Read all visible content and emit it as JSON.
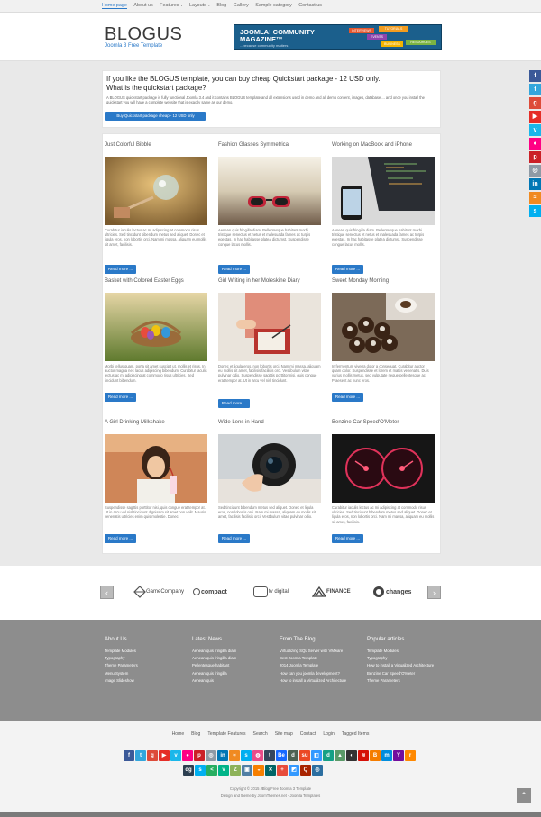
{
  "nav": {
    "items": [
      "Home page",
      "About us",
      "Features",
      "Layouts",
      "Blog",
      "Gallery",
      "Sample category",
      "Contact us"
    ],
    "dropdown_caret": "▾"
  },
  "header": {
    "title": "BLOGUS",
    "subtitle": "Joomla 3 Free Template",
    "banner_title": "JOOMLA! COMMUNITY MAGAZINE",
    "banner_tm": "™",
    "banner_sub": "...because community matters",
    "banner_tags": [
      "INTERVIEWS",
      "TUTORIALS",
      "EVENTS",
      "RESOURCES",
      "BUSINESS"
    ]
  },
  "promo": {
    "heading_line1": "If you like the BLOGUS template, you can buy cheap Quickstart package - 12 USD only.",
    "heading_line2": "What is the quickstart package?",
    "body": "A BLOGUS quickstart package is fully functional Joomla 3.4 and it contains BLOGUS template and all extensions used in demo and all demo content, images, database ... and once you install the quickstart you will have a complete website that is exactly same as our demo.",
    "button": "Buy Quickstart package cheap - 12 USD only"
  },
  "articles": [
    {
      "title": "Just Colorful Bibble",
      "desc": "Curabitur iaculis lectus ac mi adipiscing at commodo risus ultricies. Sed tincidunt bibendum metus sed aliquet. Donec et ligula eros, non lobortis orci. Nam mi massa, aliquam eu mollis sit amet, facilisis.",
      "button": "Read more ..."
    },
    {
      "title": "Fashion Glasses Symmetrical",
      "desc": "Aenean quis fringilla diam. Pellentesque habitant morbi tristique senectus et netus et malesuada fames ac turpis egestas. In hac habitasse platea dictumst. Suspendisse congue lacus mollis.",
      "button": "Read more ..."
    },
    {
      "title": "Working on MacBook and iPhone",
      "desc": "Aenean quis fringilla diam. Pellentesque habitant morbi tristique senectus et netus et malesuada fames ac turpis egestas. In hac habitasse platea dictumst. Suspendisse congue lacus mollis.",
      "button": "Read more ..."
    },
    {
      "title": "Basket with Colored Easter Eggs",
      "desc": "Morbi tellus quam, porta sit amet suscipit ut, mollis et risus. In auctor magna nec lacus adipiscing bibendum. Curabitur iaculis lectus ac mi adipiscing at commodo risus ultricies. Sed tincidunt bibendum.",
      "button": "Read more ..."
    },
    {
      "title": "Girl Writing in her Moleskine Diary",
      "desc": "Donec et ligula eros, non lobortis orci. Nam mi massa, aliquam eu mollis sit amet, facilisis facilisis orci. Vestibulum vitae pulvinar odio. Suspendisse sagittis porttitor nisi, quis congue erat tempor at. Ut in arcu vel nisl tincidunt.",
      "button": "Read more ..."
    },
    {
      "title": "Sweet Monday Morning",
      "desc": "In fermentum viverra dolor a consequat. Curabitur auctor quam dolor. Suspendisse et lorem et mattis venenatis. Duis varius mollis metus, sed vulputate neque pellentesque ac. Praesent ac nunc eros.",
      "button": "Read more ..."
    },
    {
      "title": "A Girl Drinking Milkshake",
      "desc": "Suspendisse sagittis porttitor nisi, quis congue erat tempor at. Ut in arcu vel nisl tincidunt dignissim sit amet non velit. Mauris venenatis ultricies enim quis molestie. Donec.",
      "button": "Read more ..."
    },
    {
      "title": "Wide Lens in Hand",
      "desc": "Sed tincidunt bibendum metus sed aliquet. Donec et ligula eros, non lobortis orci. Nam mi massa, aliquam eu mollis sit amet, facilisis facilisis orci. Vestibulum vitae pulvinar odio.",
      "button": "Read more ..."
    },
    {
      "title": "Benzine Car Speed'O'Meter",
      "desc": "Curabitur iaculis lectus ac mi adipiscing at commodo risus ultricies. Sed tincidunt bibendum metus sed aliquet. Donec et ligula eros, non lobortis orci. Nam mi massa, aliquam eu mollis sit amet, facilisis.",
      "button": "Read more ..."
    }
  ],
  "partners": {
    "prev": "‹",
    "next": "›",
    "logos": [
      "GameCompany",
      "compact",
      "tv digital",
      "FINANCE",
      "changes"
    ]
  },
  "footer": {
    "columns": [
      {
        "heading": "About Us",
        "links": [
          "Template Modules",
          "Typography",
          "Theme Parameters",
          "Menu System",
          "Image Slideshow"
        ]
      },
      {
        "heading": "Latest News",
        "links": [
          "Aenean quis fringilla diam",
          "Aenean quis fringilla diam",
          "Pellentesque habitant",
          "Aenean quis fringilla",
          "Aenean quis"
        ]
      },
      {
        "heading": "From The Blog",
        "links": [
          "Virtualizing SQL Server with VMware",
          "Best Joomla Template",
          "2014 Joomla Template",
          "How can you joomla development?",
          "How to install a Virtualized Architecture"
        ]
      },
      {
        "heading": "Popular articles",
        "links": [
          "Template Modules",
          "Typography",
          "How to install a Virtualized Architecture",
          "Benzine Car Speed'O'Meter",
          "Theme Parameters"
        ]
      }
    ]
  },
  "bottom": {
    "links": [
      "Home",
      "Blog",
      "Template Features",
      "Search",
      "Site map",
      "Contact",
      "Login",
      "Tagged Items"
    ],
    "copyright": "Copyright © 2015 JBlog Free Joomla 3 Template",
    "credit": "Design and theme by JoomThemes.net - Joomla Templates",
    "to_top": "⌃"
  },
  "side_social": [
    {
      "icon": "facebook-icon",
      "glyph": "f",
      "color": "#3b5998"
    },
    {
      "icon": "twitter-icon",
      "glyph": "t",
      "color": "#33a6dc"
    },
    {
      "icon": "google-plus-icon",
      "glyph": "g",
      "color": "#dd4b39"
    },
    {
      "icon": "youtube-icon",
      "glyph": "▶",
      "color": "#e52d27"
    },
    {
      "icon": "vimeo-icon",
      "glyph": "v",
      "color": "#1ab7ea"
    },
    {
      "icon": "flickr-icon",
      "glyph": "●",
      "color": "#ff0084"
    },
    {
      "icon": "pinterest-icon",
      "glyph": "p",
      "color": "#cb2027"
    },
    {
      "icon": "picasa-icon",
      "glyph": "◎",
      "color": "#8e9aa5"
    },
    {
      "icon": "linkedin-icon",
      "glyph": "in",
      "color": "#0077b5"
    },
    {
      "icon": "rss-icon",
      "glyph": "≈",
      "color": "#f08a21"
    },
    {
      "icon": "skype-icon",
      "glyph": "s",
      "color": "#00aff0"
    }
  ],
  "icon_row1": [
    {
      "icon": "facebook-icon",
      "glyph": "f",
      "color": "#3b5998"
    },
    {
      "icon": "twitter-icon",
      "glyph": "t",
      "color": "#33a6dc"
    },
    {
      "icon": "google-plus-icon",
      "glyph": "g",
      "color": "#dd4b39"
    },
    {
      "icon": "youtube-icon",
      "glyph": "▶",
      "color": "#e52d27"
    },
    {
      "icon": "vimeo-icon",
      "glyph": "v",
      "color": "#1ab7ea"
    },
    {
      "icon": "flickr-icon",
      "glyph": "●",
      "color": "#ff0084"
    },
    {
      "icon": "pinterest-icon",
      "glyph": "p",
      "color": "#cb2027"
    },
    {
      "icon": "picasa-icon",
      "glyph": "◎",
      "color": "#8e9aa5"
    },
    {
      "icon": "linkedin-icon",
      "glyph": "in",
      "color": "#0077b5"
    },
    {
      "icon": "rss-icon",
      "glyph": "≈",
      "color": "#f08a21"
    },
    {
      "icon": "skype-icon",
      "glyph": "s",
      "color": "#00aff0"
    },
    {
      "icon": "dribbble-icon",
      "glyph": "◍",
      "color": "#ea4c89"
    },
    {
      "icon": "tumblr-icon",
      "glyph": "t",
      "color": "#35465c"
    },
    {
      "icon": "behance-icon",
      "glyph": "Be",
      "color": "#1769ff"
    },
    {
      "icon": "deviantart-icon",
      "glyph": "d",
      "color": "#4e6252"
    },
    {
      "icon": "stumbleupon-icon",
      "glyph": "su",
      "color": "#eb4924"
    },
    {
      "icon": "delicious-icon",
      "glyph": "◧",
      "color": "#3399ff"
    },
    {
      "icon": "digg-icon",
      "glyph": "d",
      "color": "#16a085"
    },
    {
      "icon": "forrst-icon",
      "glyph": "▲",
      "color": "#5b9a68"
    },
    {
      "icon": "github-icon",
      "glyph": "◐",
      "color": "#333"
    },
    {
      "icon": "lastfm-icon",
      "glyph": "≋",
      "color": "#d51007"
    },
    {
      "icon": "blogger-icon",
      "glyph": "B",
      "color": "#f57d00"
    },
    {
      "icon": "myspace-icon",
      "glyph": "m",
      "color": "#008dde"
    },
    {
      "icon": "yahoo-icon",
      "glyph": "Y",
      "color": "#720e9e"
    },
    {
      "icon": "reddit-icon",
      "glyph": "r",
      "color": "#ff8800"
    }
  ],
  "icon_row2": [
    {
      "icon": "digg-icon",
      "glyph": "dg",
      "color": "#2c3e50"
    },
    {
      "icon": "skype-icon",
      "glyph": "s",
      "color": "#00aff0"
    },
    {
      "icon": "share-icon",
      "glyph": "<",
      "color": "#27ae60"
    },
    {
      "icon": "vine-icon",
      "glyph": "v",
      "color": "#00b488"
    },
    {
      "icon": "zerply-icon",
      "glyph": "Z",
      "color": "#8db259"
    },
    {
      "icon": "instagram-icon",
      "glyph": "▣",
      "color": "#517fa4"
    },
    {
      "icon": "grooveshark-icon",
      "glyph": "◒",
      "color": "#f77f00"
    },
    {
      "icon": "xing-icon",
      "glyph": "✕",
      "color": "#026466"
    },
    {
      "icon": "plus-icon",
      "glyph": "+",
      "color": "#e74c3c"
    },
    {
      "icon": "delicious-icon",
      "glyph": "◩",
      "color": "#3399ff"
    },
    {
      "icon": "quora-icon",
      "glyph": "Q",
      "color": "#a82400"
    },
    {
      "icon": "github-icon",
      "glyph": "◎",
      "color": "#2c6ea0"
    }
  ],
  "colors": {
    "accent": "#2a79c8",
    "footer_bg": "#8d8d8d"
  }
}
